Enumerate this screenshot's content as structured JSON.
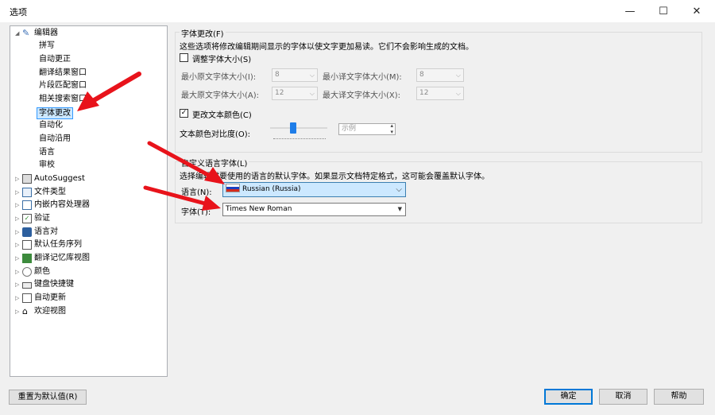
{
  "window": {
    "title": "选项",
    "minimize": "—",
    "maximize": "☐",
    "close": "✕"
  },
  "tree": {
    "root": {
      "label": "编辑器",
      "icon": "pencil-icon"
    },
    "children": [
      "拼写",
      "自动更正",
      "翻译结果窗口",
      "片段匹配窗口",
      "相关搜索窗口",
      "字体更改",
      "自动化",
      "自动沿用",
      "语言",
      "审校"
    ],
    "selected": "字体更改",
    "others": [
      {
        "label": "AutoSuggest",
        "icon": "autosuggest-icon"
      },
      {
        "label": "文件类型",
        "icon": "file-types-icon"
      },
      {
        "label": "内嵌内容处理器",
        "icon": "embedded-content-icon"
      },
      {
        "label": "验证",
        "icon": "verification-icon"
      },
      {
        "label": "语言对",
        "icon": "language-pair-icon"
      },
      {
        "label": "默认任务序列",
        "icon": "task-sequence-icon"
      },
      {
        "label": "翻译记忆库视图",
        "icon": "tm-view-icon"
      },
      {
        "label": "颜色",
        "icon": "color-icon"
      },
      {
        "label": "键盘快捷键",
        "icon": "keyboard-icon"
      },
      {
        "label": "自动更新",
        "icon": "auto-update-icon"
      },
      {
        "label": "欢迎视图",
        "icon": "home-icon"
      }
    ]
  },
  "font_change": {
    "title": "字体更改(F)",
    "desc": "这些选项将修改编辑期间显示的字体以使文字更加易读。它们不会影响生成的文档。",
    "adjust_size_label": "调整字体大小(S)",
    "adjust_size_checked": false,
    "min_source_label": "最小原文字体大小(I):",
    "min_source_value": "8",
    "min_target_label": "最小译文字体大小(M):",
    "min_target_value": "8",
    "max_source_label": "最大原文字体大小(A):",
    "max_source_value": "12",
    "max_target_label": "最大译文字体大小(X):",
    "max_target_value": "12",
    "change_color_label": "更改文本颜色(C)",
    "change_color_checked": true,
    "contrast_label": "文本颜色对比度(O):",
    "sample_text": "示例"
  },
  "custom_font": {
    "title": "自定义语言字体(L)",
    "desc": "选择编辑时要使用的语言的默认字体。如果显示文档特定格式，这可能会覆盖默认字体。",
    "language_label": "语言(N):",
    "language_value": "Russian (Russia)",
    "font_label": "字体(T):",
    "font_value": "Times New Roman"
  },
  "buttons": {
    "reset": "重置为默认值(R)",
    "ok": "确定",
    "cancel": "取消",
    "help": "帮助"
  },
  "colors": {
    "arrow": "#e8131b",
    "selection": "#cce8ff",
    "accent": "#0078d7"
  }
}
